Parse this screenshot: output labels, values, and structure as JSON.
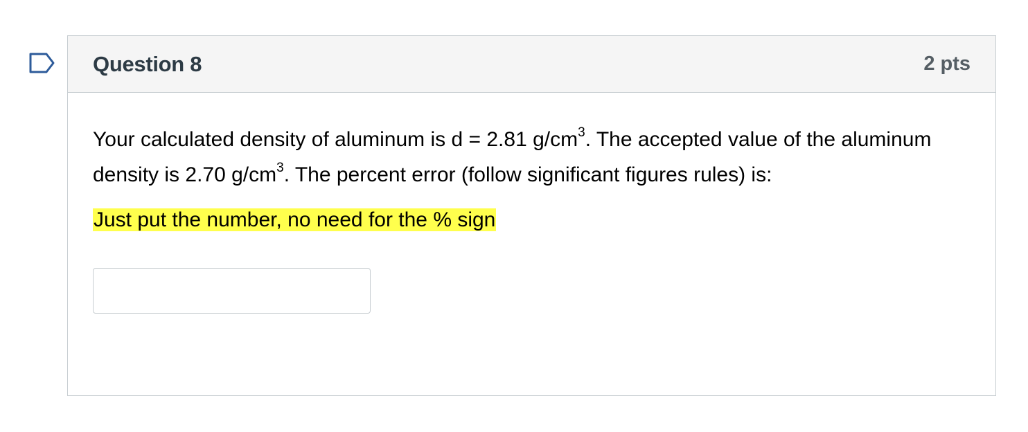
{
  "question": {
    "title": "Question 8",
    "points": "2 pts",
    "text": {
      "part1": "Your calculated density of aluminum is d = 2.81 g/cm",
      "sup1": "3",
      "part2": ". The accepted value of the aluminum density is 2.70 g/cm",
      "sup2": "3",
      "part3": ".  The percent error (follow significant figures rules) is:"
    },
    "hint": "Just put the number, no need for the % sign"
  },
  "answer": {
    "value": "",
    "placeholder": ""
  },
  "icons": {
    "flag": "flag-outline-icon"
  },
  "colors": {
    "header_bg": "#f5f5f5",
    "border": "#c7cdd1",
    "title_text": "#2d3b45",
    "flag_stroke": "#2d5b9a",
    "highlight": "#ffff4d"
  }
}
